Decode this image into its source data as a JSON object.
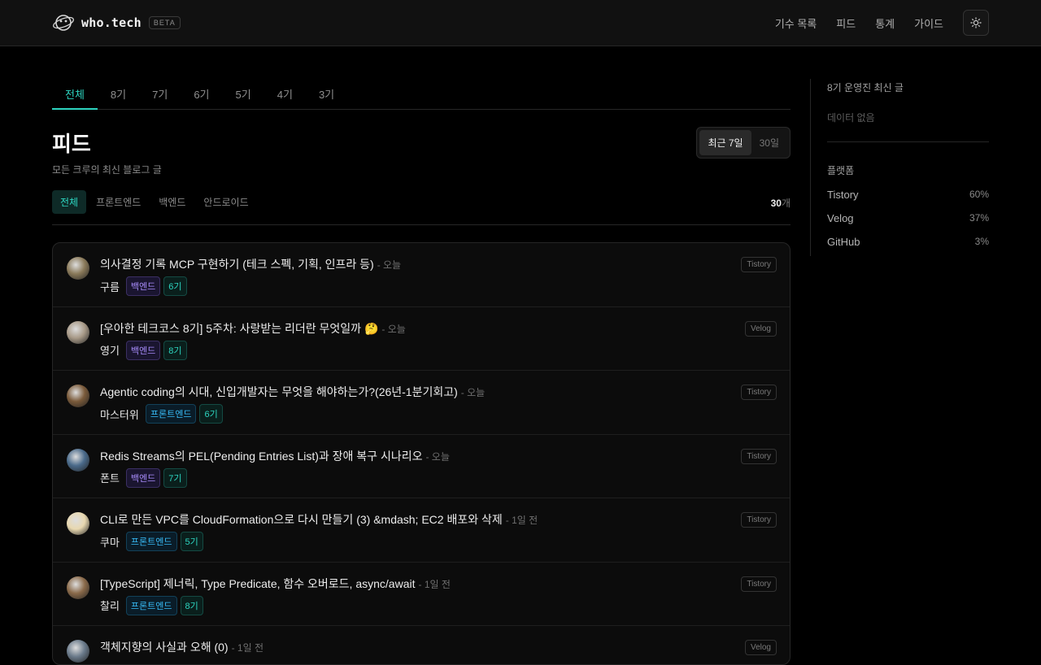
{
  "header": {
    "logo_text": "who.tech",
    "beta_label": "BETA",
    "nav": [
      "기수 목록",
      "피드",
      "통계",
      "가이드"
    ],
    "theme_icon": "sun-icon"
  },
  "generation_tabs": [
    "전체",
    "8기",
    "7기",
    "6기",
    "5기",
    "4기",
    "3기"
  ],
  "page": {
    "title": "피드",
    "subtitle": "모든 크루의 최신 블로그 글",
    "period_options": [
      "최근 7일",
      "30일"
    ]
  },
  "filters": [
    "전체",
    "프론트엔드",
    "백엔드",
    "안드로이드"
  ],
  "count": {
    "value": "30",
    "unit": "개"
  },
  "feed": [
    {
      "title": "의사결정 기록 MCP 구현하기 (테크 스펙, 기획, 인프라 등)",
      "time": "- 오늘",
      "author": "구름",
      "track": "백엔드",
      "gen": "6기",
      "platform": "Tistory",
      "avatar_color": "#8a7a5a"
    },
    {
      "title": "[우아한 테크코스 8기] 5주차: 사랑받는 리더란 무엇일까 🤔",
      "time": "- 오늘",
      "author": "영기",
      "track": "백엔드",
      "gen": "8기",
      "platform": "Velog",
      "avatar_color": "#a89a88"
    },
    {
      "title": "Agentic coding의 시대, 신입개발자는 무엇을 해야하는가?(26년-1분기회고)",
      "time": "- 오늘",
      "author": "마스터위",
      "track": "프론트엔드",
      "gen": "6기",
      "platform": "Tistory",
      "avatar_color": "#7a5a3a"
    },
    {
      "title": "Redis Streams의 PEL(Pending Entries List)과 장애 복구 시나리오",
      "time": "- 오늘",
      "author": "폰트",
      "track": "백엔드",
      "gen": "7기",
      "platform": "Tistory",
      "avatar_color": "#4a6a8a"
    },
    {
      "title": "CLI로 만든 VPC를 CloudFormation으로 다시 만들기 (3) &mdash; EC2 배포와 삭제",
      "time": "- 1일 전",
      "author": "쿠마",
      "track": "프론트엔드",
      "gen": "5기",
      "platform": "Tistory",
      "avatar_color": "#e8d8b0"
    },
    {
      "title": "[TypeScript] 제너릭, Type Predicate, 함수 오버로드, async/await",
      "time": "- 1일 전",
      "author": "찰리",
      "track": "프론트엔드",
      "gen": "8기",
      "platform": "Tistory",
      "avatar_color": "#8a6a4a"
    },
    {
      "title": "객체지향의 사실과 오해 (0)",
      "time": "- 1일 전",
      "author": "",
      "track": "",
      "gen": "",
      "platform": "Velog",
      "avatar_color": "#6a7a8a"
    }
  ],
  "aside": {
    "recent_title": "8기 운영진 최신 글",
    "recent_empty": "데이터 없음",
    "platform_title": "플랫폼",
    "platforms": [
      {
        "name": "Tistory",
        "pct": "60%"
      },
      {
        "name": "Velog",
        "pct": "37%"
      },
      {
        "name": "GitHub",
        "pct": "3%"
      }
    ]
  }
}
